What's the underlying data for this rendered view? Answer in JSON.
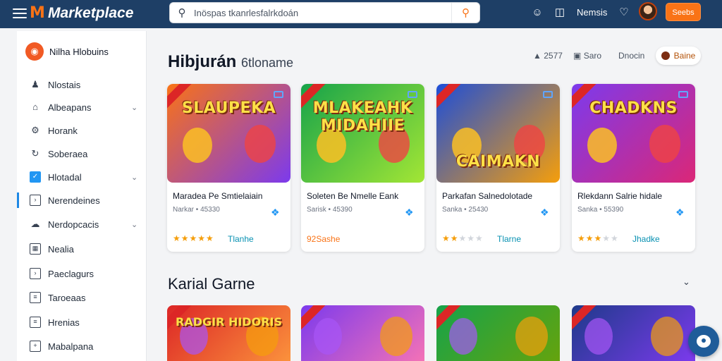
{
  "header": {
    "logo_letter": "M",
    "title": "Marketplace",
    "search": {
      "placeholder": "Inöspas tkanrlesfalrkdoán"
    },
    "user_name": "Nemsis",
    "cta_label": "Seebs"
  },
  "sidebar": {
    "brand_label": "Nilha Hlobuins",
    "items": [
      {
        "label": "Nlostais",
        "icon": "person-icon",
        "chevron": false
      },
      {
        "label": "Albeapans",
        "icon": "home-icon",
        "chevron": true
      },
      {
        "label": "Horank",
        "icon": "gear-icon",
        "chevron": false
      },
      {
        "label": "Soberaea",
        "icon": "refresh-icon",
        "chevron": false
      },
      {
        "label": "Hlotadal",
        "icon": "checkbox-icon",
        "chevron": true
      },
      {
        "label": "Nerendeines",
        "icon": "square-icon",
        "chevron": false,
        "active": true
      },
      {
        "label": "Nerdopcacis",
        "icon": "cloud-icon",
        "chevron": true
      },
      {
        "label": "Nealia",
        "icon": "calendar-icon",
        "chevron": false
      },
      {
        "label": "Paeclagurs",
        "icon": "square-icon",
        "chevron": false
      },
      {
        "label": "Taroeaas",
        "icon": "list-icon",
        "chevron": false
      },
      {
        "label": "Hrenias",
        "icon": "list-icon",
        "chevron": false
      },
      {
        "label": "Mabalpana",
        "icon": "plus-box-icon",
        "chevron": false
      }
    ]
  },
  "section1": {
    "title": "Hibjurán",
    "subtitle": "6tloname",
    "filters": [
      {
        "label": "2577",
        "icon": "chart-icon"
      },
      {
        "label": "Saro",
        "icon": "image-icon"
      },
      {
        "label": "Dnocin",
        "icon": ""
      }
    ],
    "active_filter": "Baine"
  },
  "cards": [
    {
      "thumb_text": "SLAUPEKA",
      "title": "Maradea Pe Smtielaiain",
      "meta": "Narkar • 45330",
      "rating": 5,
      "badge": "Tlanhe",
      "badge_style": "teal",
      "colors": [
        "#f97316",
        "#7c3aed"
      ]
    },
    {
      "thumb_text": "MLAKEAHK MIDAHIIE",
      "title": "Soleten Be Nmelle Eank",
      "meta": "Sarisk • 45390",
      "rating": 0,
      "badge": "92Sashe",
      "badge_style": "orange",
      "colors": [
        "#16a34a",
        "#a3e635"
      ]
    },
    {
      "thumb_text": "CAIMAKN",
      "title": "Parkafan Salnedolotade",
      "meta": "Sanka • 25430",
      "rating": 2,
      "badge": "Tlarne",
      "badge_style": "teal",
      "colors": [
        "#1d4ed8",
        "#f59e0b"
      ]
    },
    {
      "thumb_text": "CHADKNS",
      "title": "Rlekdann Salrie hidale",
      "meta": "Sanka • 55390",
      "rating": 3,
      "badge": "Jhadke",
      "badge_style": "teal",
      "colors": [
        "#7c3aed",
        "#db2777"
      ]
    }
  ],
  "section2": {
    "title": "Karial Garne"
  },
  "cards2": [
    {
      "thumb_text": "RADGIR HIDORIS",
      "colors": [
        "#dc2626",
        "#fb923c"
      ]
    },
    {
      "thumb_text": "",
      "colors": [
        "#7c3aed",
        "#f472b6"
      ]
    },
    {
      "thumb_text": "",
      "colors": [
        "#16a34a",
        "#65a30d"
      ]
    },
    {
      "thumb_text": "",
      "colors": [
        "#1e3a8a",
        "#7c3aed"
      ]
    }
  ]
}
